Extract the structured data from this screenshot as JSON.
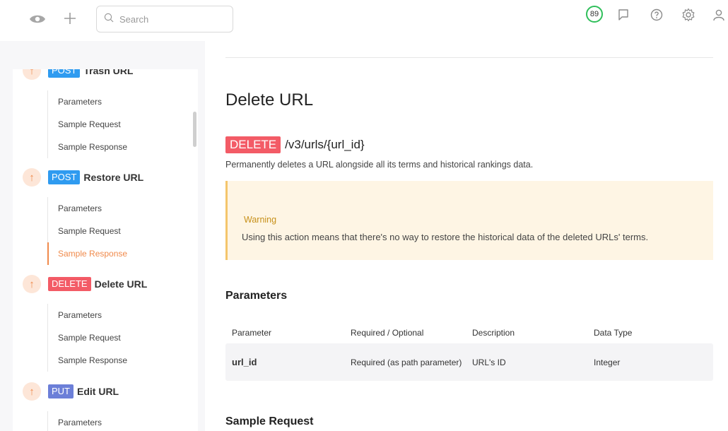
{
  "topbar": {
    "search_placeholder": "Search",
    "score": "89",
    "icons": [
      "eye-icon",
      "plus-icon",
      "search-icon",
      "comment-icon",
      "help-icon",
      "gear-icon",
      "user-icon"
    ]
  },
  "sidebar": {
    "endpoints": [
      {
        "method": "POST",
        "name": "Trash URL",
        "subitems": [
          "Parameters",
          "Sample Request",
          "Sample Response"
        ]
      },
      {
        "method": "POST",
        "name": "Restore URL",
        "subitems": [
          "Parameters",
          "Sample Request",
          "Sample Response"
        ],
        "active_subitem": "Sample Response"
      },
      {
        "method": "DELETE",
        "name": "Delete URL",
        "subitems": [
          "Parameters",
          "Sample Request",
          "Sample Response"
        ]
      },
      {
        "method": "PUT",
        "name": "Edit URL",
        "subitems": [
          "Parameters"
        ]
      }
    ]
  },
  "main": {
    "title": "Delete URL",
    "method": "DELETE",
    "path": "/v3/urls/{url_id}",
    "description": "Permanently deletes a URL alongside all its terms and historical rankings data.",
    "warning": {
      "title": "Warning",
      "text": "Using this action means that there's no way to restore the historical data of the deleted URLs' terms."
    },
    "parameters_heading": "Parameters",
    "table": {
      "headers": [
        "Parameter",
        "Required / Optional",
        "Description",
        "Data Type"
      ],
      "rows": [
        [
          "url_id",
          "Required (as path parameter)",
          "URL's ID",
          "Integer"
        ]
      ]
    },
    "sample_request_heading": "Sample Request"
  },
  "colors": {
    "post": "#2f9bf0",
    "delete": "#f35b66",
    "put": "#6c7fd8",
    "accent": "#f08a4b",
    "warning_bg": "#fef5e4",
    "warning_title": "#c79019",
    "score_ring": "#2fbf5a"
  }
}
